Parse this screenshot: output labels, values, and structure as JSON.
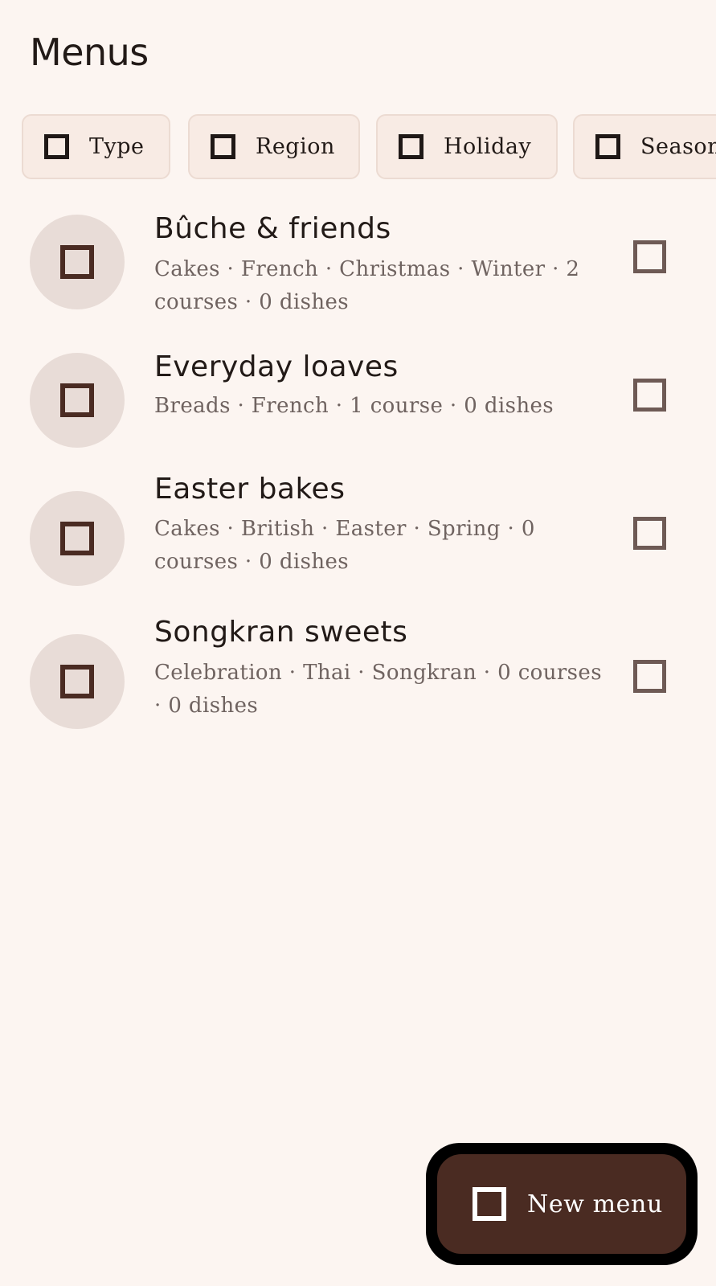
{
  "header": {
    "title": "Menus"
  },
  "filters": [
    {
      "label": "Type",
      "icon": "checkbox-icon"
    },
    {
      "label": "Region",
      "icon": "checkbox-icon"
    },
    {
      "label": "Holiday",
      "icon": "checkbox-icon"
    },
    {
      "label": "Season",
      "icon": "checkbox-icon"
    }
  ],
  "menus": [
    {
      "title": "Bûche & friends",
      "subtitle": "Cakes · French · Christmas · Winter · 2 courses · 0 dishes"
    },
    {
      "title": "Everyday loaves",
      "subtitle": "Breads · French · 1 course · 0 dishes"
    },
    {
      "title": "Easter bakes",
      "subtitle": "Cakes · British · Easter · Spring · 0 courses · 0 dishes"
    },
    {
      "title": "Songkran sweets",
      "subtitle": "Celebration · Thai · Songkran · 0 courses · 0 dishes"
    }
  ],
  "fab": {
    "label": "New menu",
    "icon": "add-icon"
  },
  "colors": {
    "background": "#fcf5f1",
    "chip_background": "#f8ebe4",
    "avatar_background": "#e8dcd7",
    "accent": "#4a2b22",
    "text_primary": "#221a17",
    "text_secondary": "#6f6360"
  }
}
